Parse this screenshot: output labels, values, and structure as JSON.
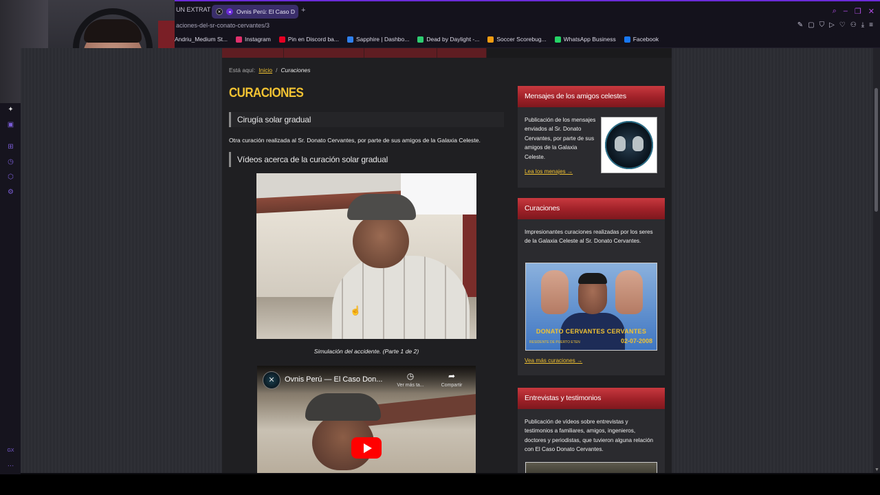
{
  "browser": {
    "tab_prev_label": "UN EXTRAT",
    "tab_active_label": "Ovnis Perú: El Caso D",
    "url": "aciones-del-sr-conato-cervantes/3",
    "bookmarks": [
      {
        "label": "Andriu_Medium St...",
        "color": "#c0392b"
      },
      {
        "label": "Instagram",
        "color": "#e1306c"
      },
      {
        "label": "Pin en Discord ba...",
        "color": "#e60023"
      },
      {
        "label": "Sapphire | Dashbo...",
        "color": "#2f80ed"
      },
      {
        "label": "Dead by Daylight -...",
        "color": "#2ecc71"
      },
      {
        "label": "Soccer Scorebug...",
        "color": "#f39c12"
      },
      {
        "label": "WhatsApp Business",
        "color": "#25d366"
      },
      {
        "label": "Facebook",
        "color": "#1877f2"
      }
    ]
  },
  "site": {
    "breadcrumb": {
      "prefix": "Está aquí:",
      "home": "Inicio",
      "separator": "/",
      "current": "Curaciones"
    },
    "page_title": "CURACIONES",
    "section_title": "Cirugía solar gradual",
    "intro": "Otra curación realizada al Sr. Donato Cervantes, por parte de sus amigos de la Galaxia Celeste.",
    "videos_heading": "Vídeos acerca de la curación solar gradual",
    "video1_caption": "Simulación del accidente. (Parte 1 de 2)",
    "video2": {
      "title": "Ovnis Perú — El Caso Don...",
      "watch_later": "Ver más ta...",
      "share": "Compartir"
    }
  },
  "widgets": {
    "mensajes": {
      "title": "Mensajes de los amigos celestes",
      "text": "Publicación de los mensajes enviados al Sr. Donato Cervantes, por parte de sus amigos de la Galaxia Celeste.",
      "link": "Lea los menajes →"
    },
    "curaciones": {
      "title": "Curaciones",
      "text": "Impresionantes curaciones realizadas por los seres de la Galaxia Celeste al Sr. Donato Cervantes.",
      "image_name": "DONATO CERVANTES CERVANTES",
      "image_place": "RESIDENTE DE PUERTO ETEN",
      "image_date": "02-07-2008",
      "link": "Vea más curaciones →"
    },
    "entrevistas": {
      "title": "Entrevistas y testimonios",
      "text": "Publicación de vídeos sobre entrevistas y testimonios a familiares, amigos, ingenieros, doctores y periodistas, que tuvieron alguna relación con El Caso Donato Cervantes."
    }
  }
}
